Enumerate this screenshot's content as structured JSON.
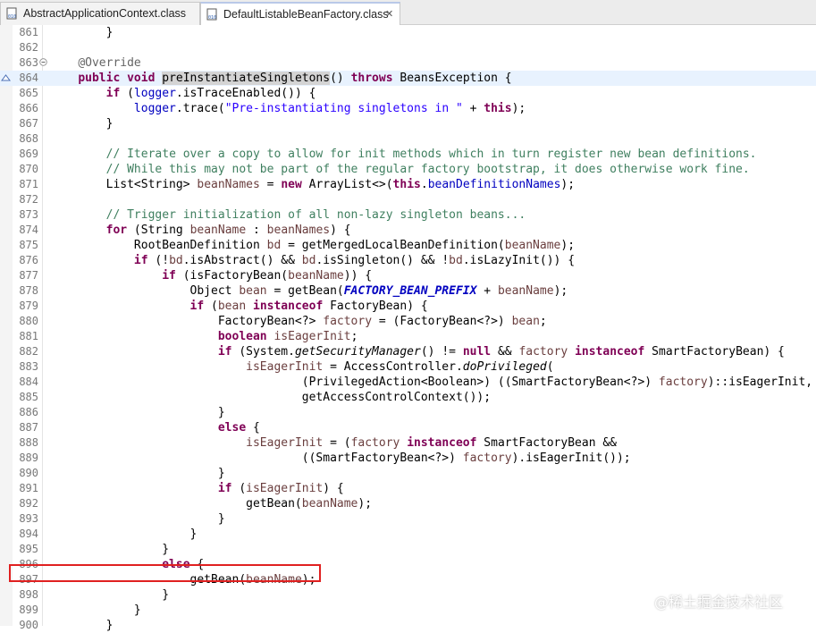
{
  "tabs": [
    {
      "label": "AbstractApplicationContext.class",
      "icon": "class-file-icon",
      "active": false
    },
    {
      "label": "DefaultListableBeanFactory.class",
      "icon": "class-file-icon",
      "active": true,
      "close_label": "✕"
    }
  ],
  "watermark": "@稀土掘金技术社区",
  "lines": [
    {
      "num": "861",
      "html": "        }"
    },
    {
      "num": "862",
      "html": ""
    },
    {
      "num": "863",
      "html": "    <span class=\"a\">@Override</span>",
      "fold": true
    },
    {
      "num": "864",
      "html": "    <span class=\"k\">public</span> <span class=\"k\">void</span> <span class=\"mh\">preInstantiateSingletons</span>() <span class=\"k\">throws</span> BeansException {",
      "highlight": true,
      "override_marker": true
    },
    {
      "num": "865",
      "html": "        <span class=\"k\">if</span> (<span class=\"f\">logger</span>.isTraceEnabled()) {"
    },
    {
      "num": "866",
      "html": "            <span class=\"f\">logger</span>.trace(<span class=\"s\">\"Pre-instantiating singletons in \"</span> + <span class=\"k\">this</span>);"
    },
    {
      "num": "867",
      "html": "        }"
    },
    {
      "num": "868",
      "html": ""
    },
    {
      "num": "869",
      "html": "        <span class=\"c\">// Iterate over a copy to allow for init methods which in turn register new bean definitions.</span>"
    },
    {
      "num": "870",
      "html": "        <span class=\"c\">// While this may not be part of the regular factory bootstrap, it does otherwise work fine.</span>"
    },
    {
      "num": "871",
      "html": "        List&lt;String&gt; <span class=\"v\">beanNames</span> = <span class=\"k\">new</span> ArrayList&lt;&gt;(<span class=\"k\">this</span>.<span class=\"f\">beanDefinitionNames</span>);"
    },
    {
      "num": "872",
      "html": ""
    },
    {
      "num": "873",
      "html": "        <span class=\"c\">// Trigger initialization of all non-lazy singleton beans...</span>"
    },
    {
      "num": "874",
      "html": "        <span class=\"k\">for</span> (String <span class=\"v\">beanName</span> : <span class=\"v\">beanNames</span>) {"
    },
    {
      "num": "875",
      "html": "            RootBeanDefinition <span class=\"v\">bd</span> = getMergedLocalBeanDefinition(<span class=\"v\">beanName</span>);"
    },
    {
      "num": "876",
      "html": "            <span class=\"k\">if</span> (!<span class=\"v\">bd</span>.isAbstract() &amp;&amp; <span class=\"v\">bd</span>.isSingleton() &amp;&amp; !<span class=\"v\">bd</span>.isLazyInit()) {"
    },
    {
      "num": "877",
      "html": "                <span class=\"k\">if</span> (isFactoryBean(<span class=\"v\">beanName</span>)) {"
    },
    {
      "num": "878",
      "html": "                    Object <span class=\"v\">bean</span> = getBean(<span class=\"sf\">FACTORY_BEAN_PREFIX</span> + <span class=\"v\">beanName</span>);"
    },
    {
      "num": "879",
      "html": "                    <span class=\"k\">if</span> (<span class=\"v\">bean</span> <span class=\"k\">instanceof</span> FactoryBean) {"
    },
    {
      "num": "880",
      "html": "                        FactoryBean&lt;?&gt; <span class=\"v\">factory</span> = (FactoryBean&lt;?&gt;) <span class=\"v\">bean</span>;"
    },
    {
      "num": "881",
      "html": "                        <span class=\"k\">boolean</span> <span class=\"v\">isEagerInit</span>;"
    },
    {
      "num": "882",
      "html": "                        <span class=\"k\">if</span> (System.<span class=\"i\">getSecurityManager</span>() != <span class=\"k\">null</span> &amp;&amp; <span class=\"v\">factory</span> <span class=\"k\">instanceof</span> SmartFactoryBean) {"
    },
    {
      "num": "883",
      "html": "                            <span class=\"v\">isEagerInit</span> = AccessController.<span class=\"i\">doPrivileged</span>("
    },
    {
      "num": "884",
      "html": "                                    (PrivilegedAction&lt;Boolean&gt;) ((SmartFactoryBean&lt;?&gt;) <span class=\"v\">factory</span>)::isEagerInit,"
    },
    {
      "num": "885",
      "html": "                                    getAccessControlContext());"
    },
    {
      "num": "886",
      "html": "                        }"
    },
    {
      "num": "887",
      "html": "                        <span class=\"k\">else</span> {"
    },
    {
      "num": "888",
      "html": "                            <span class=\"v\">isEagerInit</span> = (<span class=\"v\">factory</span> <span class=\"k\">instanceof</span> SmartFactoryBean &amp;&amp;"
    },
    {
      "num": "889",
      "html": "                                    ((SmartFactoryBean&lt;?&gt;) <span class=\"v\">factory</span>).isEagerInit());"
    },
    {
      "num": "890",
      "html": "                        }"
    },
    {
      "num": "891",
      "html": "                        <span class=\"k\">if</span> (<span class=\"v\">isEagerInit</span>) {"
    },
    {
      "num": "892",
      "html": "                            getBean(<span class=\"v\">beanName</span>);"
    },
    {
      "num": "893",
      "html": "                        }"
    },
    {
      "num": "894",
      "html": "                    }"
    },
    {
      "num": "895",
      "html": "                }"
    },
    {
      "num": "896",
      "html": "                <span class=\"k\">else</span> {"
    },
    {
      "num": "897",
      "html": "                    getBean(<span class=\"v\">beanName</span>);"
    },
    {
      "num": "898",
      "html": "                }"
    },
    {
      "num": "899",
      "html": "            }"
    },
    {
      "num": "900",
      "html": "        }"
    }
  ]
}
